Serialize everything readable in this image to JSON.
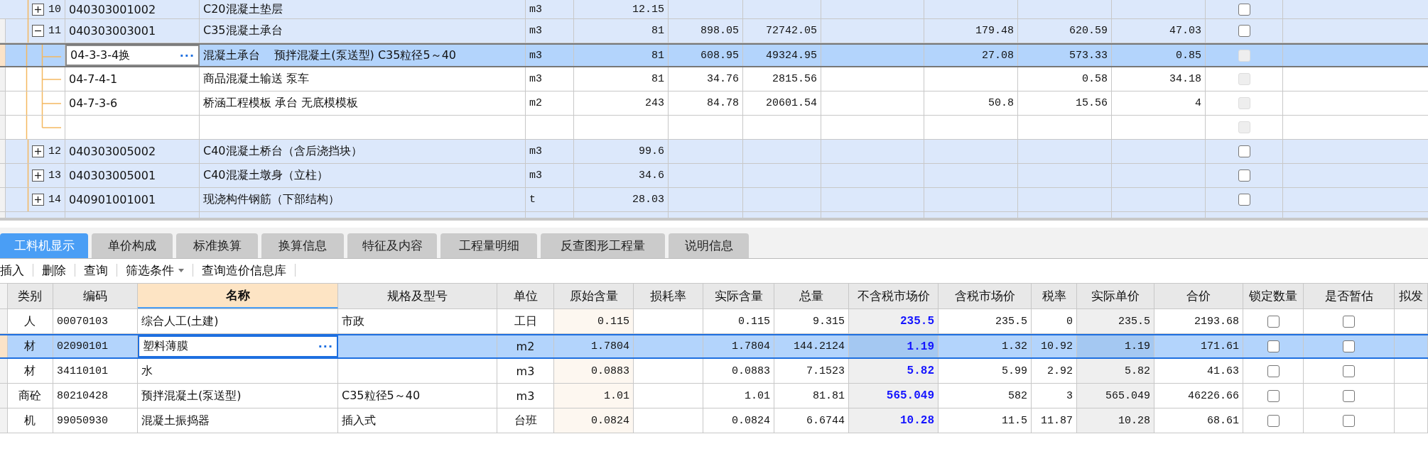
{
  "top_table": {
    "edit_button": "···",
    "rows": [
      {
        "kind": "item",
        "number": "10",
        "code": "040303001002",
        "name": "C20混凝土垫层",
        "unit": "m3",
        "cells": [
          "12.15",
          null,
          null,
          null,
          null,
          null,
          null
        ],
        "expanded": false,
        "checked": false,
        "selected": false
      },
      {
        "kind": "item",
        "number": "11",
        "code": "040303003001",
        "name": "C35混凝土承台",
        "unit": "m3",
        "cells": [
          "81",
          "898.05",
          "72742.05",
          null,
          "179.48",
          "620.59",
          "47.03"
        ],
        "expanded": true,
        "checked": false,
        "selected": false
      },
      {
        "kind": "sub",
        "code": "04-3-3-4换",
        "name": "混凝土承台    预拌混凝土(泵送型) C35粒径5～40",
        "unit": "m3",
        "cells": [
          "81",
          "608.95",
          "49324.95",
          null,
          "27.08",
          "573.33",
          "0.85"
        ],
        "checked": false,
        "selected": true
      },
      {
        "kind": "sub",
        "code": "04-7-4-1",
        "name": "商品混凝土输送 泵车",
        "unit": "m3",
        "cells": [
          "81",
          "34.76",
          "2815.56",
          null,
          null,
          "0.58",
          "34.18"
        ],
        "checked": false,
        "selected": false
      },
      {
        "kind": "sub",
        "code": "04-7-3-6",
        "name": "桥涵工程模板 承台 无底模模板",
        "unit": "m2",
        "cells": [
          "243",
          "84.78",
          "20601.54",
          null,
          "50.8",
          "15.56",
          "4"
        ],
        "checked": false,
        "selected": false
      },
      {
        "kind": "sub",
        "cells": [
          null,
          null,
          null,
          null,
          null,
          null,
          null
        ],
        "checked": false,
        "selected": false
      },
      {
        "kind": "item",
        "number": "12",
        "code": "040303005002",
        "name": "C40混凝土桥台（含后浇挡块）",
        "unit": "m3",
        "cells": [
          "99.6",
          null,
          null,
          null,
          null,
          null,
          null
        ],
        "expanded": false,
        "checked": false,
        "selected": false
      },
      {
        "kind": "item",
        "number": "13",
        "code": "040303005001",
        "name": "C40混凝土墩身（立柱）",
        "unit": "m3",
        "cells": [
          "34.6",
          null,
          null,
          null,
          null,
          null,
          null
        ],
        "expanded": false,
        "checked": false,
        "selected": false
      },
      {
        "kind": "item",
        "number": "14",
        "code": "040901001001",
        "name": "现浇构件钢筋（下部结构）",
        "unit": "t",
        "cells": [
          "28.03",
          null,
          null,
          null,
          null,
          null,
          null
        ],
        "expanded": false,
        "checked": false,
        "selected": false
      }
    ]
  },
  "tabs": [
    {
      "label": "工料机显示",
      "selected": true
    },
    {
      "label": "单价构成",
      "selected": false
    },
    {
      "label": "标准换算",
      "selected": false
    },
    {
      "label": "换算信息",
      "selected": false
    },
    {
      "label": "特征及内容",
      "selected": false
    },
    {
      "label": "工程量明细",
      "selected": false
    },
    {
      "label": "反查图形工程量",
      "selected": false
    },
    {
      "label": "说明信息",
      "selected": false
    }
  ],
  "toolbar": [
    {
      "label": "插入"
    },
    {
      "label": "删除"
    },
    {
      "label": "查询"
    },
    {
      "label": "筛选条件",
      "dropdown": true
    },
    {
      "label": "查询造价信息库"
    }
  ],
  "bottom_table": {
    "edit_button": "···",
    "columns": [
      {
        "label": "类别",
        "selected": false
      },
      {
        "label": "编码",
        "selected": false
      },
      {
        "label": "名称",
        "selected": true
      },
      {
        "label": "规格及型号",
        "selected": false
      },
      {
        "label": "单位",
        "selected": false
      },
      {
        "label": "原始含量",
        "selected": false
      },
      {
        "label": "损耗率",
        "selected": false
      },
      {
        "label": "实际含量",
        "selected": false
      },
      {
        "label": "总量",
        "selected": false
      },
      {
        "label": "不含税市场价",
        "selected": false
      },
      {
        "label": "含税市场价",
        "selected": false
      },
      {
        "label": "税率",
        "selected": false
      },
      {
        "label": "实际单价",
        "selected": false
      },
      {
        "label": "合价",
        "selected": false
      },
      {
        "label": "锁定数量",
        "selected": false
      },
      {
        "label": "是否暂估",
        "selected": false
      },
      {
        "label": "拟发",
        "selected": false
      }
    ],
    "rows": [
      {
        "category": "人",
        "code": "00070103",
        "name": "综合人工(土建)",
        "spec": "市政",
        "unit": "工日",
        "original_qty": "0.115",
        "actual_qty": "0.115",
        "total": "9.315",
        "price_ex_tax": "235.5",
        "price_inc_tax": "235.5",
        "tax_rate": "0",
        "actual_price": "235.5",
        "amount": "2193.68",
        "locked": false,
        "provisional": false,
        "selected": false
      },
      {
        "category": "材",
        "code": "02090101",
        "name": "塑料薄膜",
        "unit": "m2",
        "original_qty": "1.7804",
        "actual_qty": "1.7804",
        "total": "144.2124",
        "price_ex_tax": "1.19",
        "price_inc_tax": "1.32",
        "tax_rate": "10.92",
        "actual_price": "1.19",
        "amount": "171.61",
        "locked": false,
        "provisional": false,
        "selected": true
      },
      {
        "category": "材",
        "code": "34110101",
        "name": "水",
        "unit": "m3",
        "original_qty": "0.0883",
        "actual_qty": "0.0883",
        "total": "7.1523",
        "price_ex_tax": "5.82",
        "price_inc_tax": "5.99",
        "tax_rate": "2.92",
        "actual_price": "5.82",
        "amount": "41.63",
        "locked": false,
        "provisional": false,
        "selected": false
      },
      {
        "category": "商砼",
        "code": "80210428",
        "name": "预拌混凝土(泵送型)",
        "spec": "C35粒径5～40",
        "unit": "m3",
        "original_qty": "1.01",
        "actual_qty": "1.01",
        "total": "81.81",
        "price_ex_tax": "565.049",
        "price_inc_tax": "582",
        "tax_rate": "3",
        "actual_price": "565.049",
        "amount": "46226.66",
        "locked": false,
        "provisional": false,
        "selected": false
      },
      {
        "category": "机",
        "code": "99050930",
        "name": "混凝土振捣器",
        "spec": "插入式",
        "unit": "台班",
        "original_qty": "0.0824",
        "actual_qty": "0.0824",
        "total": "6.6744",
        "price_ex_tax": "10.28",
        "price_inc_tax": "11.5",
        "tax_rate": "11.87",
        "actual_price": "10.28",
        "amount": "68.61",
        "locked": false,
        "provisional": false,
        "selected": false
      }
    ]
  }
}
